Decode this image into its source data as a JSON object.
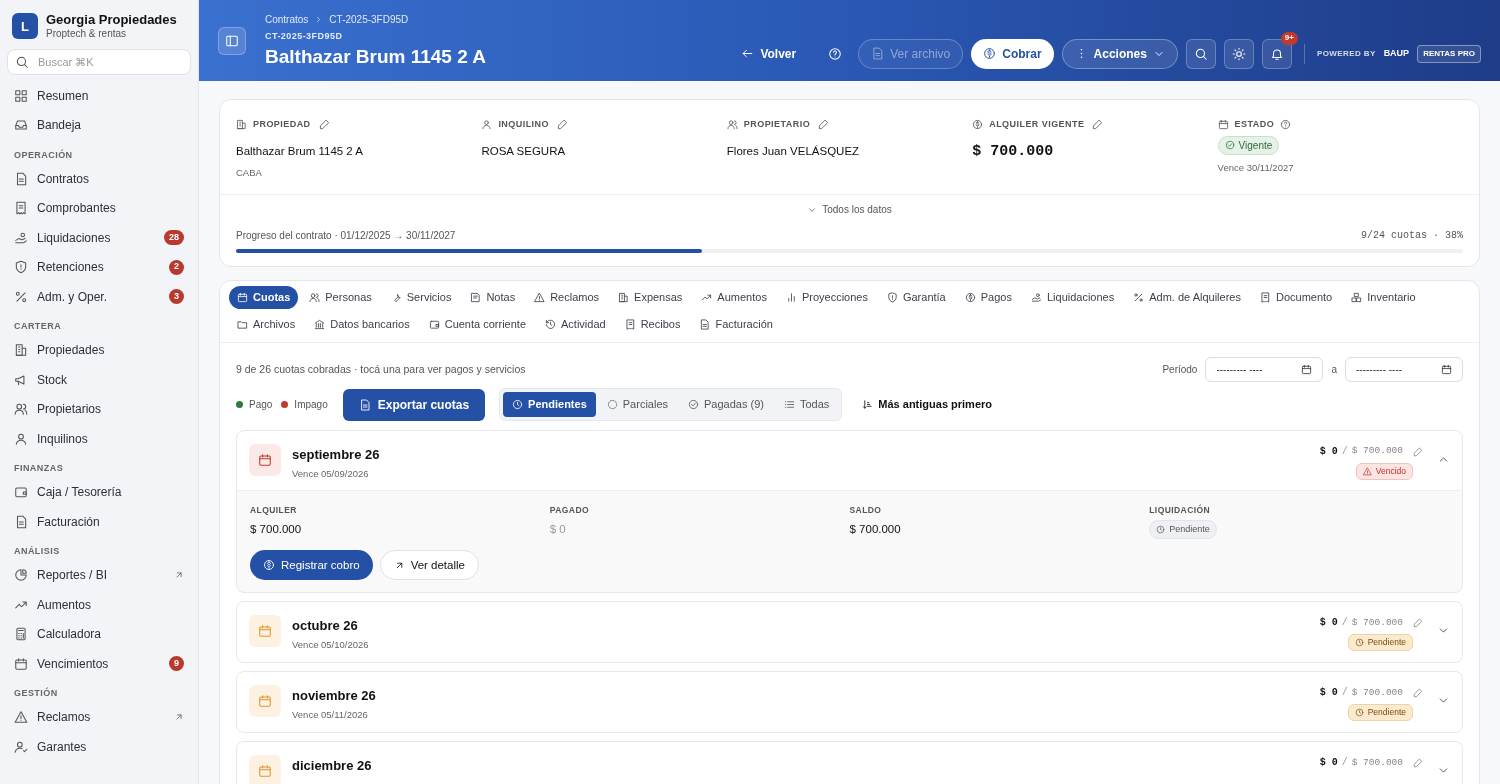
{
  "brand": {
    "logo": "L",
    "name": "Georgia Propiedades",
    "tagline": "Proptech & rentas"
  },
  "search": {
    "placeholder": "Buscar ⌘K"
  },
  "sidebar": {
    "sections": [
      {
        "items": [
          {
            "label": "Resumen"
          },
          {
            "label": "Bandeja"
          }
        ]
      },
      {
        "title": "OPERACIÓN",
        "items": [
          {
            "label": "Contratos"
          },
          {
            "label": "Comprobantes"
          },
          {
            "label": "Liquidaciones",
            "badge": "28"
          },
          {
            "label": "Retenciones",
            "badge": "2"
          },
          {
            "label": "Adm. y Oper.",
            "badge": "3"
          }
        ]
      },
      {
        "title": "CARTERA",
        "items": [
          {
            "label": "Propiedades"
          },
          {
            "label": "Stock"
          },
          {
            "label": "Propietarios"
          },
          {
            "label": "Inquilinos"
          }
        ]
      },
      {
        "title": "FINANZAS",
        "items": [
          {
            "label": "Caja / Tesorería"
          },
          {
            "label": "Facturación"
          }
        ]
      },
      {
        "title": "ANÁLISIS",
        "items": [
          {
            "label": "Reportes / BI",
            "external": true
          },
          {
            "label": "Aumentos"
          },
          {
            "label": "Calculadora"
          },
          {
            "label": "Vencimientos",
            "badge": "9"
          }
        ]
      },
      {
        "title": "GESTIÓN",
        "items": [
          {
            "label": "Reclamos",
            "external": true
          },
          {
            "label": "Garantes"
          }
        ]
      }
    ]
  },
  "header": {
    "breadcrumbs": [
      "Contratos",
      "CT-2025-3FD95D"
    ],
    "code": "CT-2025-3FD95D",
    "title": "Balthazar Brum 1145 2 A",
    "actions": [
      {
        "kind": "back",
        "label": "Volver"
      },
      {
        "kind": "help"
      },
      {
        "kind": "disabled",
        "label": "Ver archivo"
      },
      {
        "kind": "primary",
        "label": "Cobrar"
      },
      {
        "kind": "menu",
        "label": "Acciones"
      },
      {
        "kind": "search"
      },
      {
        "kind": "theme"
      },
      {
        "kind": "notifications",
        "badge": "9+"
      }
    ],
    "powered_by": "POWERED BY",
    "vendor": "BAUP",
    "plan": "RENTAS PRO"
  },
  "summary": {
    "fields": [
      {
        "label": "PROPIEDAD",
        "editable": true,
        "value": "Balthazar Brum 1145 2 A",
        "sub": "CABA"
      },
      {
        "label": "INQUILINO",
        "editable": true,
        "value": "ROSA SEGURA"
      },
      {
        "label": "PROPIETARIO",
        "editable": true,
        "value": "Flores Juan VELÁSQUEZ"
      },
      {
        "label": "ALQUILER VIGENTE",
        "editable": true,
        "value": "$ 700.000",
        "kind": "amount"
      },
      {
        "label": "ESTADO",
        "help": true,
        "badge": "Vigente",
        "sub": "Vence 30/11/2027"
      }
    ],
    "more": "Todos los datos",
    "progress_label": "Progreso del contrato · 01/12/2025 → 30/11/2027",
    "progress_reading": "9/24 cuotas · 38%",
    "level": 0.38
  },
  "tabs": [
    {
      "label": "Cuotas",
      "selected": true
    },
    {
      "label": "Personas",
      "selected": false
    },
    {
      "label": "Servicios",
      "selected": false
    },
    {
      "label": "Notas",
      "selected": false
    },
    {
      "label": "Reclamos",
      "selected": false
    },
    {
      "label": "Expensas",
      "selected": false
    },
    {
      "label": "Aumentos",
      "selected": false
    },
    {
      "label": "Proyecciones",
      "selected": false
    },
    {
      "label": "Garantía",
      "selected": false
    },
    {
      "label": "Pagos",
      "selected": false
    },
    {
      "label": "Liquidaciones",
      "selected": false
    },
    {
      "label": "Adm. de Alquileres",
      "selected": false
    },
    {
      "label": "Documento",
      "selected": false
    },
    {
      "label": "Inventario",
      "selected": false
    },
    {
      "label": "Archivos",
      "selected": false
    },
    {
      "label": "Datos bancarios",
      "selected": false
    },
    {
      "label": "Cuenta corriente",
      "selected": false
    },
    {
      "label": "Actividad",
      "selected": false
    },
    {
      "label": "Recibos",
      "selected": false
    },
    {
      "label": "Facturación",
      "selected": false
    }
  ],
  "cuotas": {
    "summary": "9 de 26 cuotas cobradas · tocá una para ver pagos y servicios",
    "period_label": "Período",
    "period_from": "--------- ----",
    "period_sep": "a",
    "period_to": "--------- ----",
    "legend": [
      {
        "label": "Pago",
        "color": "#2f7a3e"
      },
      {
        "label": "Impago",
        "color": "#c0392b"
      }
    ],
    "export": "Exportar cuotas",
    "filters": [
      {
        "label": "Pendientes",
        "selected": true
      },
      {
        "label": "Parciales",
        "selected": false
      },
      {
        "label": "Pagadas (9)",
        "selected": false
      },
      {
        "label": "Todas",
        "selected": false
      }
    ],
    "sort": "Más antiguas primero",
    "rows": [
      {
        "month": "septiembre 26",
        "due": "Vence 05/09/2026",
        "paid": "$ 0",
        "sep": "/",
        "total": "$ 700.000",
        "status": "Vencido",
        "kind": "overdue",
        "expanded": true,
        "details": [
          {
            "label": "ALQUILER",
            "value": "$ 700.000",
            "muted": false
          },
          {
            "label": "PAGADO",
            "value": "$ 0",
            "muted": true
          },
          {
            "label": "SALDO",
            "value": "$ 700.000",
            "muted": false
          },
          {
            "label": "LIQUIDACIÓN",
            "badge": "Pendiente"
          }
        ],
        "buttons": [
          {
            "label": "Registrar cobro",
            "kind": "primary"
          },
          {
            "label": "Ver detalle",
            "kind": "secondary"
          }
        ]
      },
      {
        "month": "octubre 26",
        "due": "Vence 05/10/2026",
        "paid": "$ 0",
        "sep": "/",
        "total": "$ 700.000",
        "status": "Pendiente",
        "kind": "pending",
        "expanded": false
      },
      {
        "month": "noviembre 26",
        "due": "Vence 05/11/2026",
        "paid": "$ 0",
        "sep": "/",
        "total": "$ 700.000",
        "status": "Pendiente",
        "kind": "pending",
        "expanded": false
      },
      {
        "month": "diciembre 26",
        "paid": "$ 0",
        "sep": "/",
        "total": "$ 700.000",
        "kind": "pending",
        "expanded": false
      }
    ]
  }
}
